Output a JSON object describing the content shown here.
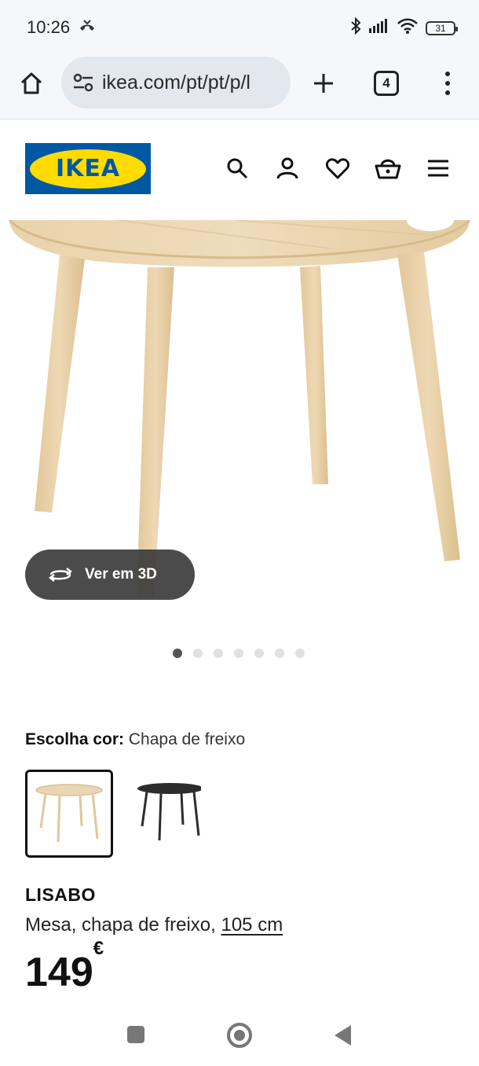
{
  "status_bar": {
    "time": "10:26",
    "battery": "31"
  },
  "browser": {
    "url": "ikea.com/pt/pt/p/l",
    "tab_count": "4"
  },
  "header": {
    "logo_text": "IKEA",
    "brand_blue": "#0058a3",
    "brand_yellow": "#ffdb00"
  },
  "gallery": {
    "view3d_label": "Ver em 3D",
    "dot_count": 7,
    "active_dot": 0
  },
  "color_choice": {
    "label": "Escolha cor:",
    "selected": "Chapa de freixo"
  },
  "product": {
    "name": "LISABO",
    "description": "Mesa, chapa de freixo,",
    "size_link": "105 cm",
    "price": "149",
    "currency": "€"
  }
}
